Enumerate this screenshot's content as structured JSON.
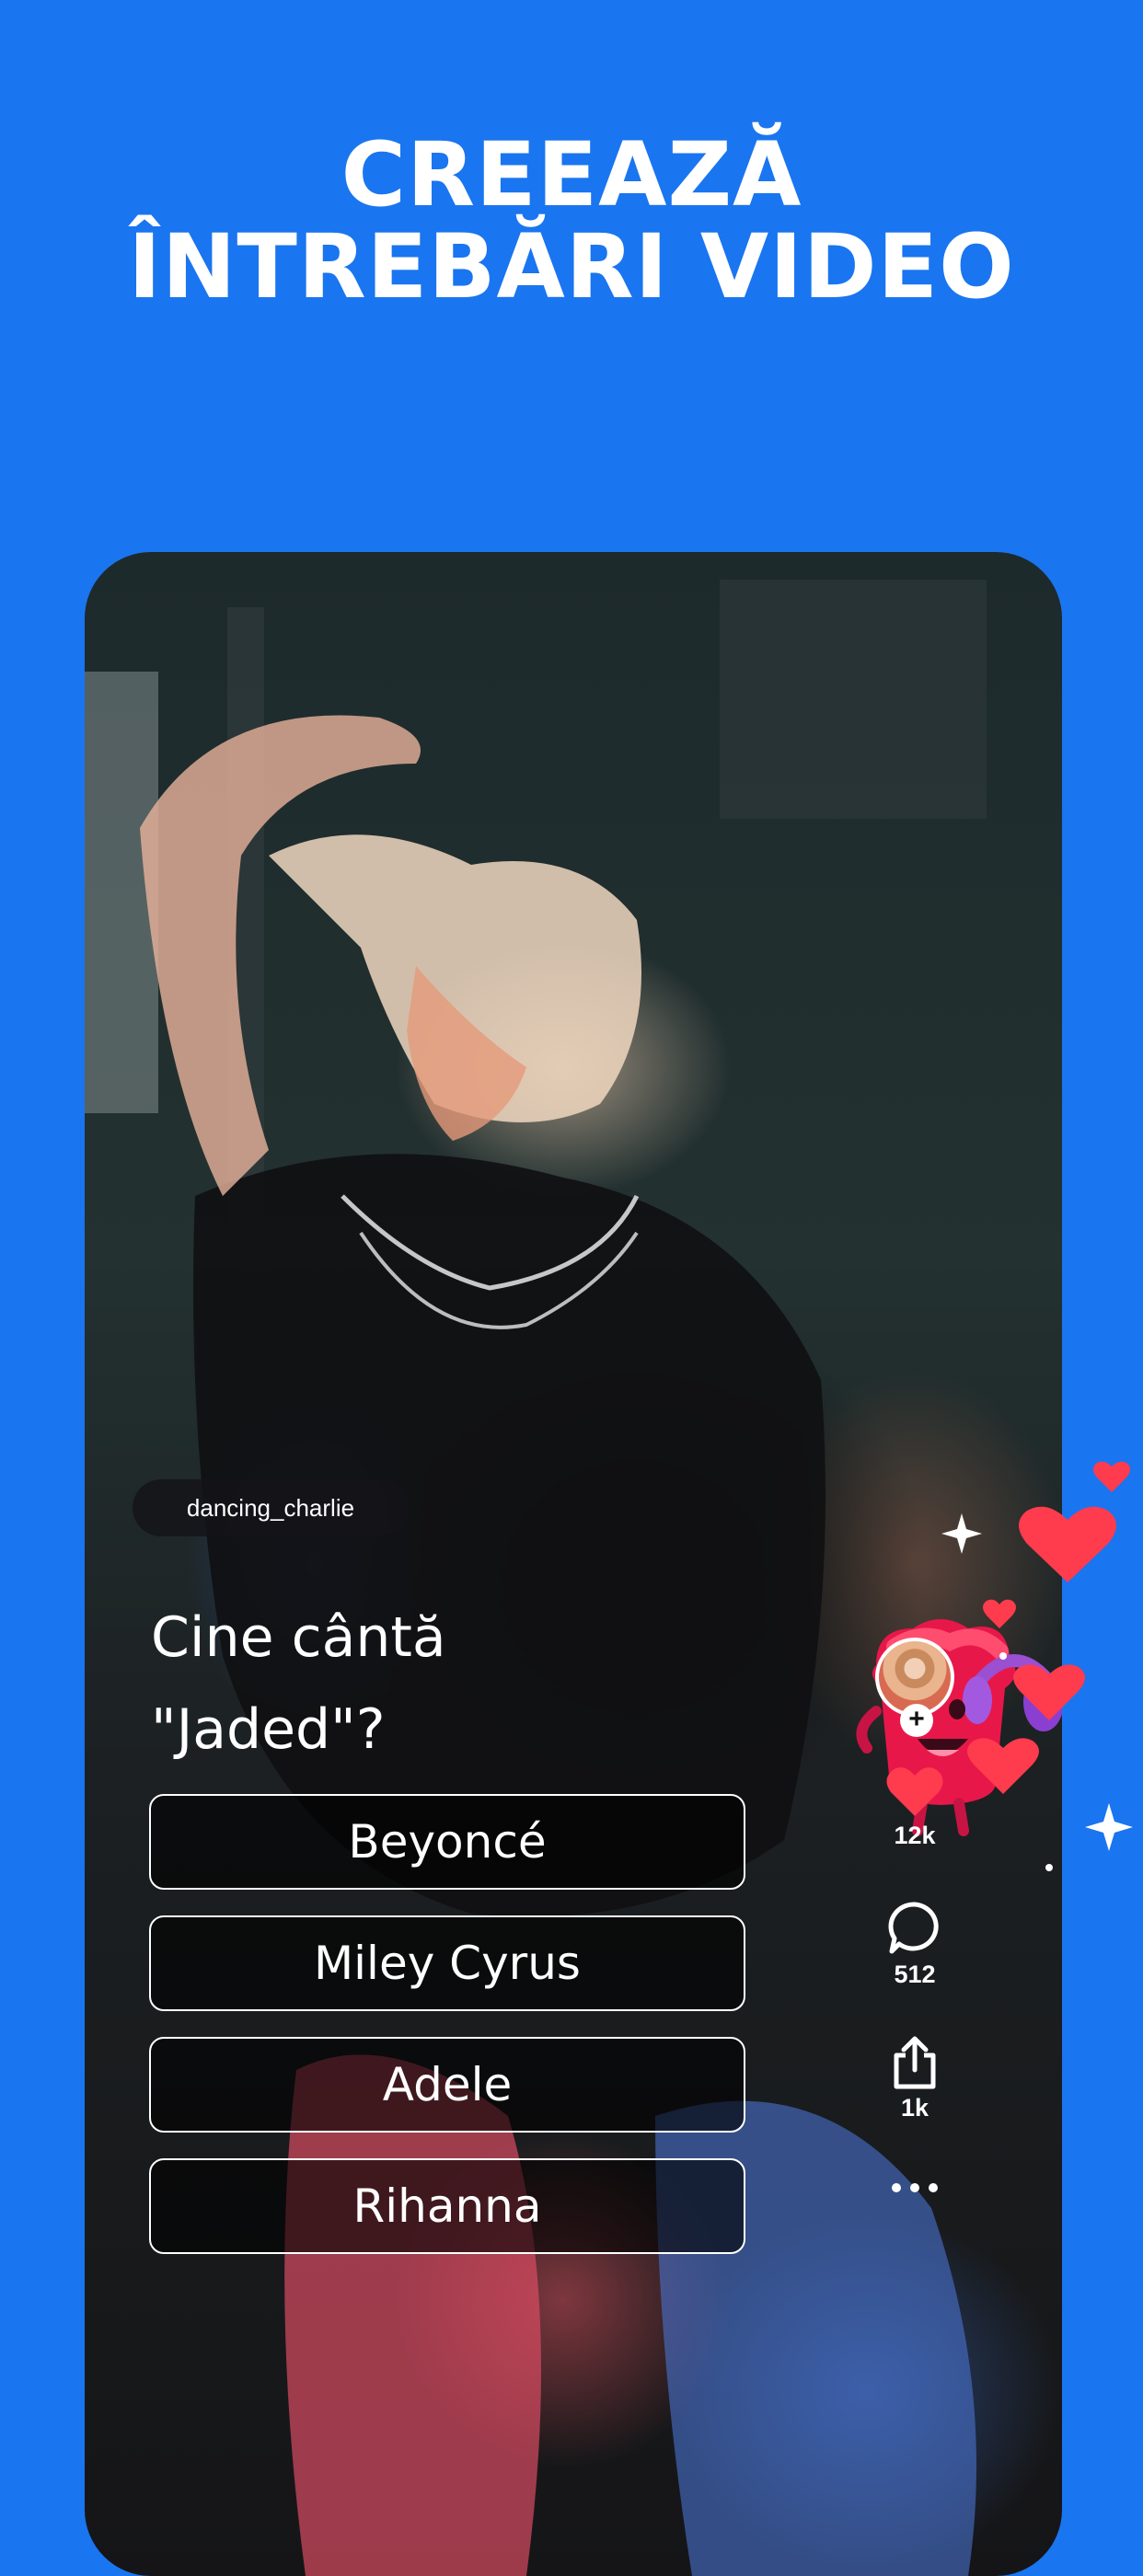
{
  "headline": {
    "line1": "CREEAZĂ",
    "line2": "ÎNTREBĂRI VIDEO"
  },
  "post": {
    "username": "dancing_charlie",
    "question_line1": "Cine cântă",
    "question_line2": "\"Jaded\"?",
    "answers": [
      "Beyoncé",
      "Miley Cyrus",
      "Adele",
      "Rihanna"
    ]
  },
  "actions": {
    "likes": "12k",
    "comments": "512",
    "shares": "1k",
    "icons": [
      "avatar",
      "follow-plus-icon",
      "heart-icon",
      "comment-icon",
      "share-icon",
      "more-icon"
    ]
  },
  "colors": {
    "background": "#1a75f0",
    "heart": "#ff3b4e",
    "answer_border": "#ffffff"
  }
}
